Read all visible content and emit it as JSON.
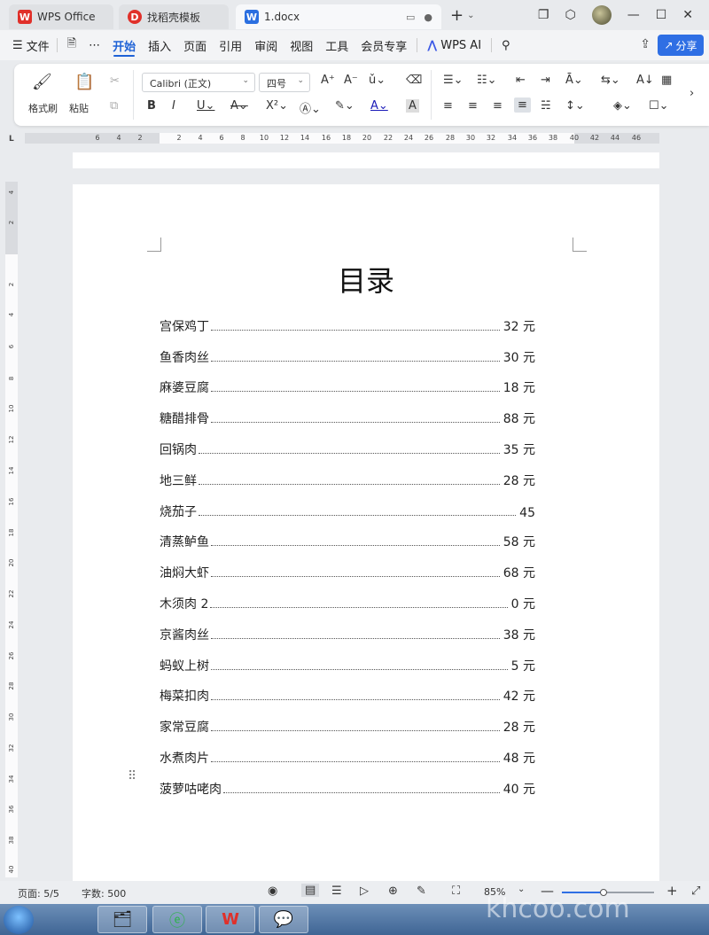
{
  "tabs": {
    "wps_office": "WPS Office",
    "template": "找稻壳模板",
    "doc": "1.docx"
  },
  "menu": {
    "file": "文件",
    "items": [
      "开始",
      "插入",
      "页面",
      "引用",
      "审阅",
      "视图",
      "工具",
      "会员专享"
    ],
    "wps_ai": "WPS AI",
    "share": "分享"
  },
  "ribbon": {
    "format_painter": "格式刷",
    "paste": "粘贴",
    "font_name": "Calibri (正文)",
    "font_size": "四号"
  },
  "ruler": {
    "h_ticks": [
      "6",
      "4",
      "2",
      "2",
      "4",
      "6",
      "8",
      "10",
      "12",
      "14",
      "16",
      "18",
      "20",
      "22",
      "24",
      "26",
      "28",
      "30",
      "32",
      "34",
      "36",
      "38",
      "40",
      "42",
      "44",
      "46"
    ],
    "v_ticks": [
      "4",
      "2",
      "2",
      "4",
      "6",
      "8",
      "10",
      "12",
      "14",
      "16",
      "18",
      "20",
      "22",
      "24",
      "26",
      "28",
      "30",
      "32",
      "34",
      "36",
      "38",
      "40"
    ]
  },
  "document": {
    "title": "目录",
    "toc": [
      {
        "name": "宫保鸡丁",
        "price": "32 元"
      },
      {
        "name": "鱼香肉丝",
        "price": "30 元"
      },
      {
        "name": "麻婆豆腐",
        "price": "18 元"
      },
      {
        "name": "糖醋排骨",
        "price": "88 元"
      },
      {
        "name": "回锅肉",
        "price": "35 元"
      },
      {
        "name": "地三鲜",
        "price": "28 元"
      },
      {
        "name": "烧茄子",
        "price": "45"
      },
      {
        "name": "清蒸鲈鱼",
        "price": "58 元"
      },
      {
        "name": "油焖大虾",
        "price": "68 元"
      },
      {
        "name": "木须肉 2",
        "price": "0 元"
      },
      {
        "name": "京酱肉丝",
        "price": "38 元"
      },
      {
        "name": "蚂蚁上树",
        "price": "5 元"
      },
      {
        "name": "梅菜扣肉",
        "price": "42 元"
      },
      {
        "name": "家常豆腐",
        "price": "28 元"
      },
      {
        "name": "水煮肉片",
        "price": "48 元"
      },
      {
        "name": "菠萝咕咾肉",
        "price": "40 元"
      }
    ]
  },
  "status": {
    "page": "页面: 5/5",
    "words": "字数: 500",
    "zoom": "85%",
    "zoom_level_percent": 45
  },
  "watermark": "khcoo.com",
  "colors": {
    "accent": "#1f62d6",
    "share_button": "#2f6fe4",
    "wps_red": "#e0302a"
  }
}
